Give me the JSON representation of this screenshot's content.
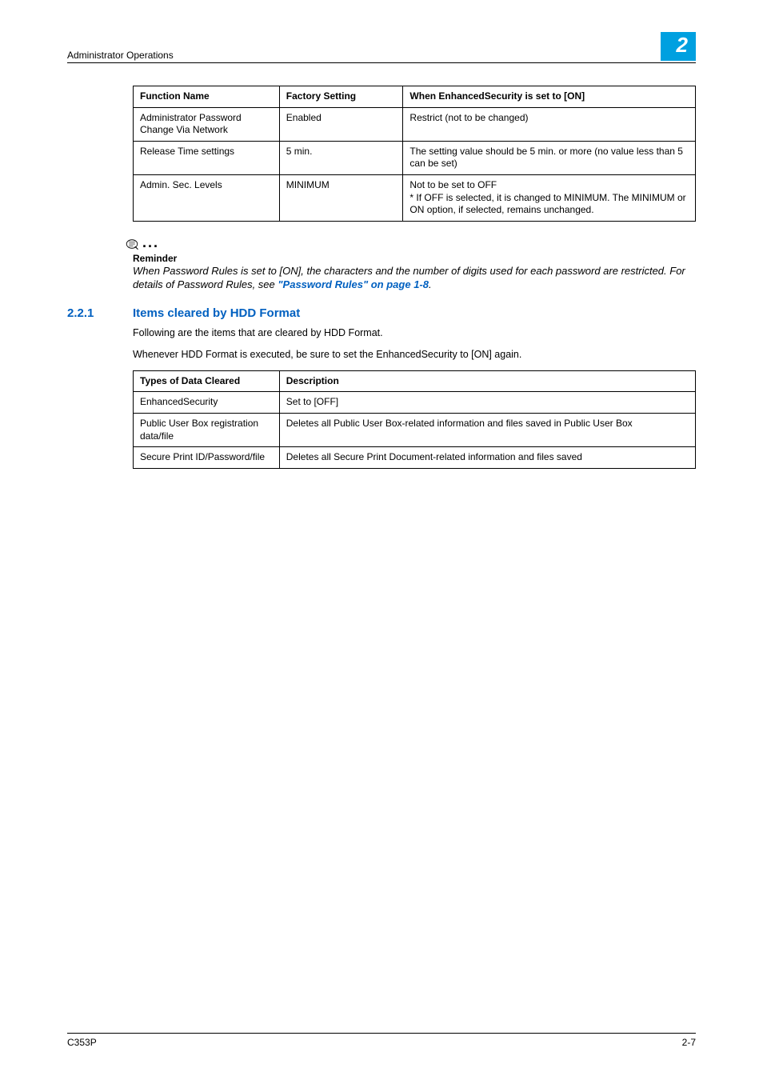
{
  "header": {
    "section": "Administrator Operations",
    "chapter": "2"
  },
  "table1": {
    "headers": {
      "c1": "Function Name",
      "c2": "Factory Setting",
      "c3": "When EnhancedSecurity is set to [ON]"
    },
    "rows": [
      {
        "c1": "Administrator Password Change Via Network",
        "c2": "Enabled",
        "c3": "Restrict (not to be changed)"
      },
      {
        "c1": "Release Time settings",
        "c2": "5 min.",
        "c3": "The setting value should be 5 min. or more (no value less than 5 can be set)"
      },
      {
        "c1": "Admin. Sec. Levels",
        "c2": "MINIMUM",
        "c3": "Not to be set to OFF\n* If OFF is selected, it is changed to MINIMUM. The MINIMUM or ON option, if selected, remains unchanged."
      }
    ]
  },
  "reminder": {
    "label": "Reminder",
    "text_a": "When Password Rules is set to [ON], the characters and the number of digits used for each password are restricted. For details of Password Rules, see ",
    "link": "\"Password Rules\" on page 1-8",
    "text_b": "."
  },
  "section": {
    "num": "2.2.1",
    "title": "Items cleared by HDD Format",
    "p1": "Following are the items that are cleared by HDD Format.",
    "p2": "Whenever HDD Format is executed, be sure to set the EnhancedSecurity to [ON] again."
  },
  "table2": {
    "headers": {
      "c1": "Types of Data Cleared",
      "c2": "Description"
    },
    "rows": [
      {
        "c1": "EnhancedSecurity",
        "c2": "Set to [OFF]"
      },
      {
        "c1": "Public User Box registration data/file",
        "c2": "Deletes all Public User Box-related information and files saved in Public User Box"
      },
      {
        "c1": "Secure Print ID/Password/file",
        "c2": "Deletes all Secure Print Document-related information and files saved"
      }
    ]
  },
  "footer": {
    "left": "C353P",
    "right": "2-7"
  }
}
